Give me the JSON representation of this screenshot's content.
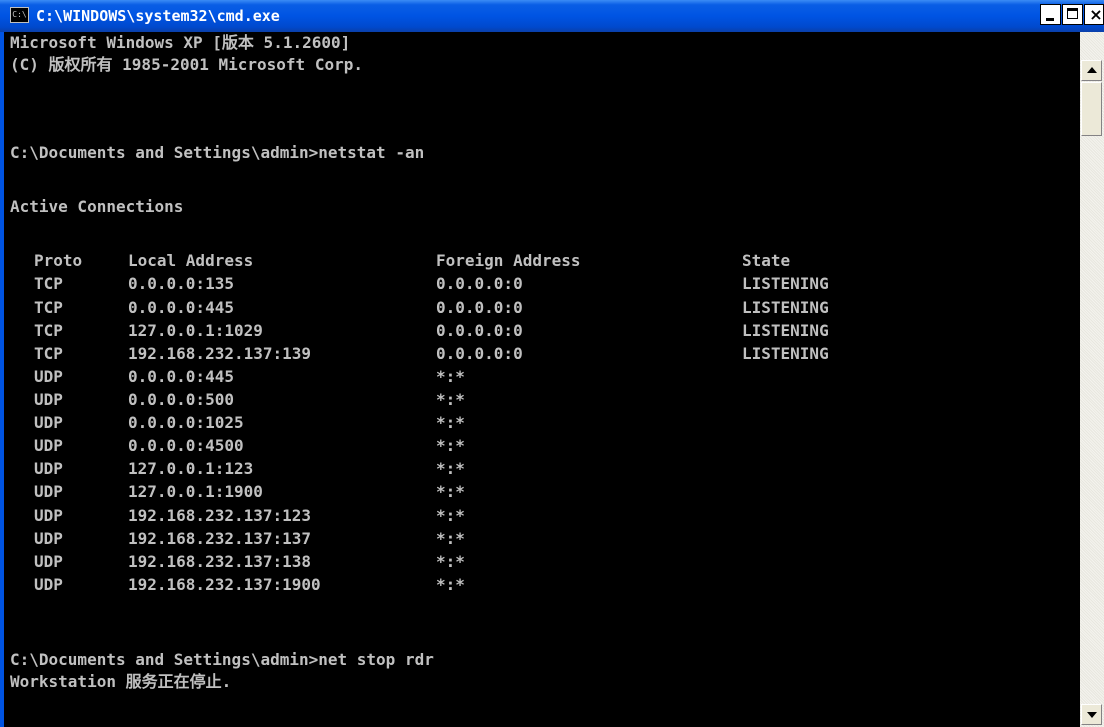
{
  "window": {
    "title": "C:\\WINDOWS\\system32\\cmd.exe",
    "icon_label": "C:\\",
    "title_bar_color": "#0054e3",
    "console_background": "#000000",
    "console_text_color": "#c0c0c0"
  },
  "console": {
    "header_line_1": "Microsoft Windows XP [版本 5.1.2600]",
    "header_line_2": "(C) 版权所有 1985-2001 Microsoft Corp.",
    "command_1": "C:\\Documents and Settings\\admin>netstat -an",
    "active_connections": "Active Connections",
    "columns": {
      "proto": "Proto",
      "local": "Local Address",
      "foreign": "Foreign Address",
      "state": "State"
    },
    "rows": [
      {
        "proto": "TCP",
        "local": "0.0.0.0:135",
        "foreign": "0.0.0.0:0",
        "state": "LISTENING"
      },
      {
        "proto": "TCP",
        "local": "0.0.0.0:445",
        "foreign": "0.0.0.0:0",
        "state": "LISTENING"
      },
      {
        "proto": "TCP",
        "local": "127.0.0.1:1029",
        "foreign": "0.0.0.0:0",
        "state": "LISTENING"
      },
      {
        "proto": "TCP",
        "local": "192.168.232.137:139",
        "foreign": "0.0.0.0:0",
        "state": "LISTENING"
      },
      {
        "proto": "UDP",
        "local": "0.0.0.0:445",
        "foreign": "*:*",
        "state": ""
      },
      {
        "proto": "UDP",
        "local": "0.0.0.0:500",
        "foreign": "*:*",
        "state": ""
      },
      {
        "proto": "UDP",
        "local": "0.0.0.0:1025",
        "foreign": "*:*",
        "state": ""
      },
      {
        "proto": "UDP",
        "local": "0.0.0.0:4500",
        "foreign": "*:*",
        "state": ""
      },
      {
        "proto": "UDP",
        "local": "127.0.0.1:123",
        "foreign": "*:*",
        "state": ""
      },
      {
        "proto": "UDP",
        "local": "127.0.0.1:1900",
        "foreign": "*:*",
        "state": ""
      },
      {
        "proto": "UDP",
        "local": "192.168.232.137:123",
        "foreign": "*:*",
        "state": ""
      },
      {
        "proto": "UDP",
        "local": "192.168.232.137:137",
        "foreign": "*:*",
        "state": ""
      },
      {
        "proto": "UDP",
        "local": "192.168.232.137:138",
        "foreign": "*:*",
        "state": ""
      },
      {
        "proto": "UDP",
        "local": "192.168.232.137:1900",
        "foreign": "*:*",
        "state": ""
      }
    ],
    "command_2": "C:\\Documents and Settings\\admin>net stop rdr",
    "output_last": "Workstation 服务正在停止."
  },
  "title_buttons": {
    "minimize_icon": "minimize-icon",
    "maximize_icon": "maximize-icon",
    "close_icon": "close-icon",
    "close_glyph": "×"
  },
  "scrollbar": {
    "up_icon": "arrow-up-icon",
    "down_icon": "arrow-down-icon"
  }
}
